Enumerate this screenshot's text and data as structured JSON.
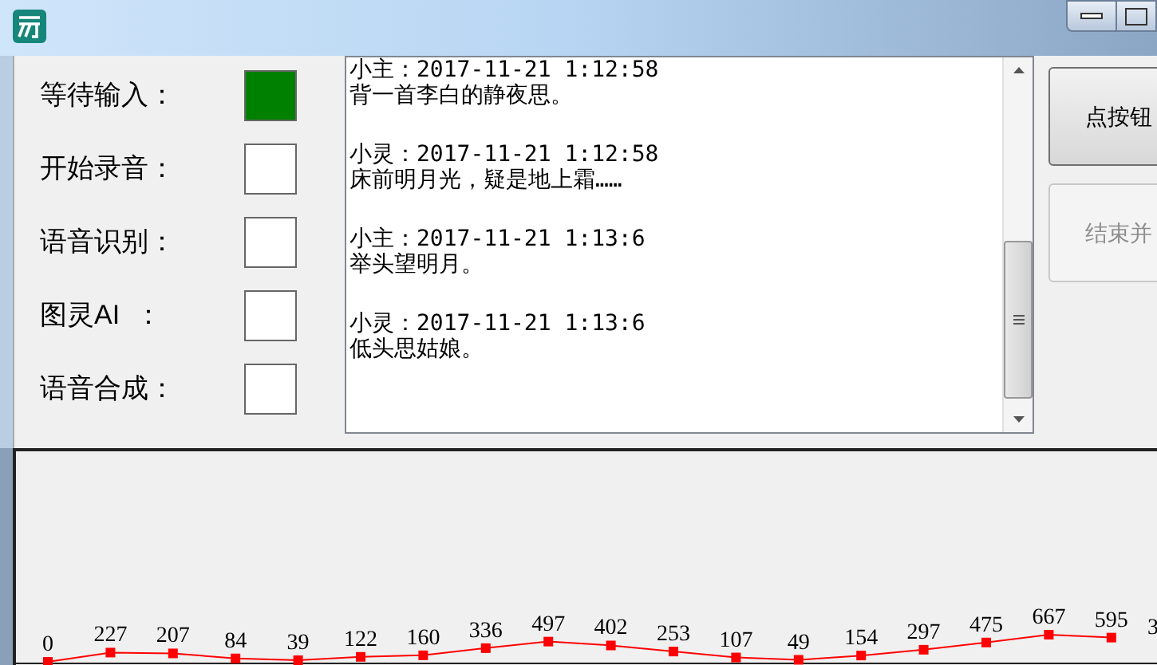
{
  "indicators": [
    {
      "label": "等待输入：",
      "on": true
    },
    {
      "label": "开始录音：",
      "on": false
    },
    {
      "label": "语音识别：",
      "on": false
    },
    {
      "label": "图灵AI  ：",
      "on": false
    },
    {
      "label": "语音合成：",
      "on": false
    }
  ],
  "chat_log": [
    {
      "header": "小主：2017-11-21 1:12:58",
      "text": "背一首李白的静夜思。"
    },
    {
      "header": "小灵：2017-11-21 1:12:58",
      "text": "床前明月光，疑是地上霜……"
    },
    {
      "header": "小主：2017-11-21 1:13:6",
      "text": "举头望明月。"
    },
    {
      "header": "小灵：2017-11-21 1:13:6",
      "text": "低头思姑娘。"
    }
  ],
  "buttons": [
    {
      "label": "点按钮",
      "disabled": false
    },
    {
      "label": "结束并",
      "disabled": true
    }
  ],
  "chart_data": {
    "type": "line",
    "data_labels": true,
    "series": [
      {
        "marker": "square",
        "color": "#ff0000",
        "values": [
          0,
          227,
          207,
          84,
          39,
          122,
          160,
          336,
          497,
          402,
          253,
          107,
          49,
          154,
          297,
          475,
          667,
          595,
          null
        ]
      }
    ],
    "value_labels": [
      "0",
      "227",
      "207",
      "84",
      "39",
      "122",
      "160",
      "336",
      "497",
      "402",
      "253",
      "107",
      "49",
      "154",
      "297",
      "475",
      "667",
      "595",
      "3"
    ]
  }
}
